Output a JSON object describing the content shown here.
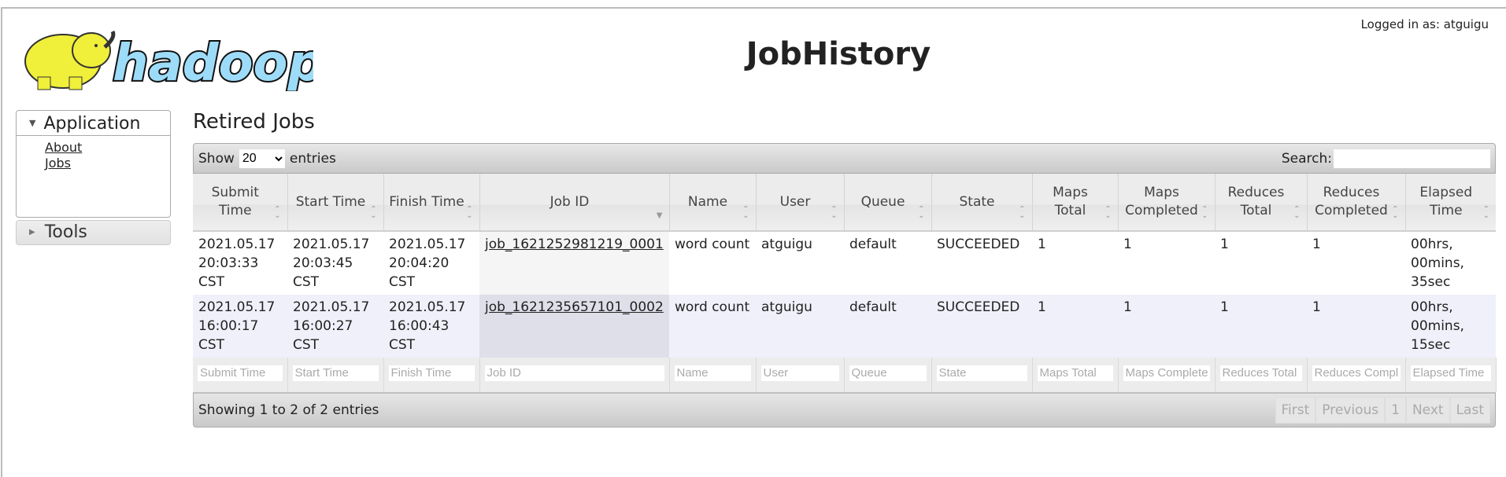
{
  "header": {
    "title": "JobHistory",
    "logged_in": "Logged in as: atguigu",
    "logo_text": "hadoop"
  },
  "sidebar": {
    "application": "Application",
    "links": [
      "About",
      "Jobs"
    ],
    "tools": "Tools"
  },
  "main": {
    "heading": "Retired Jobs",
    "show_label": "Show",
    "page_size": "20",
    "entries_label": "entries",
    "search_label": "Search:",
    "search_value": "",
    "columns": [
      "Submit Time",
      "Start Time",
      "Finish Time",
      "Job ID",
      "Name",
      "User",
      "Queue",
      "State",
      "Maps Total",
      "Maps Completed",
      "Reduces Total",
      "Reduces Completed",
      "Elapsed Time"
    ],
    "sorted_column": "Job ID",
    "rows": [
      [
        "2021.05.17 20:03:33 CST",
        "2021.05.17 20:03:45 CST",
        "2021.05.17 20:04:20 CST",
        "job_1621252981219_0001",
        "word count",
        "atguigu",
        "default",
        "SUCCEEDED",
        "1",
        "1",
        "1",
        "1",
        "00hrs, 00mins, 35sec"
      ],
      [
        "2021.05.17 16:00:17 CST",
        "2021.05.17 16:00:27 CST",
        "2021.05.17 16:00:43 CST",
        "job_1621235657101_0002",
        "word count",
        "atguigu",
        "default",
        "SUCCEEDED",
        "1",
        "1",
        "1",
        "1",
        "00hrs, 00mins, 15sec"
      ]
    ],
    "info": "Showing 1 to 2 of 2 entries",
    "pagination": [
      "First",
      "Previous",
      "1",
      "Next",
      "Last"
    ]
  }
}
